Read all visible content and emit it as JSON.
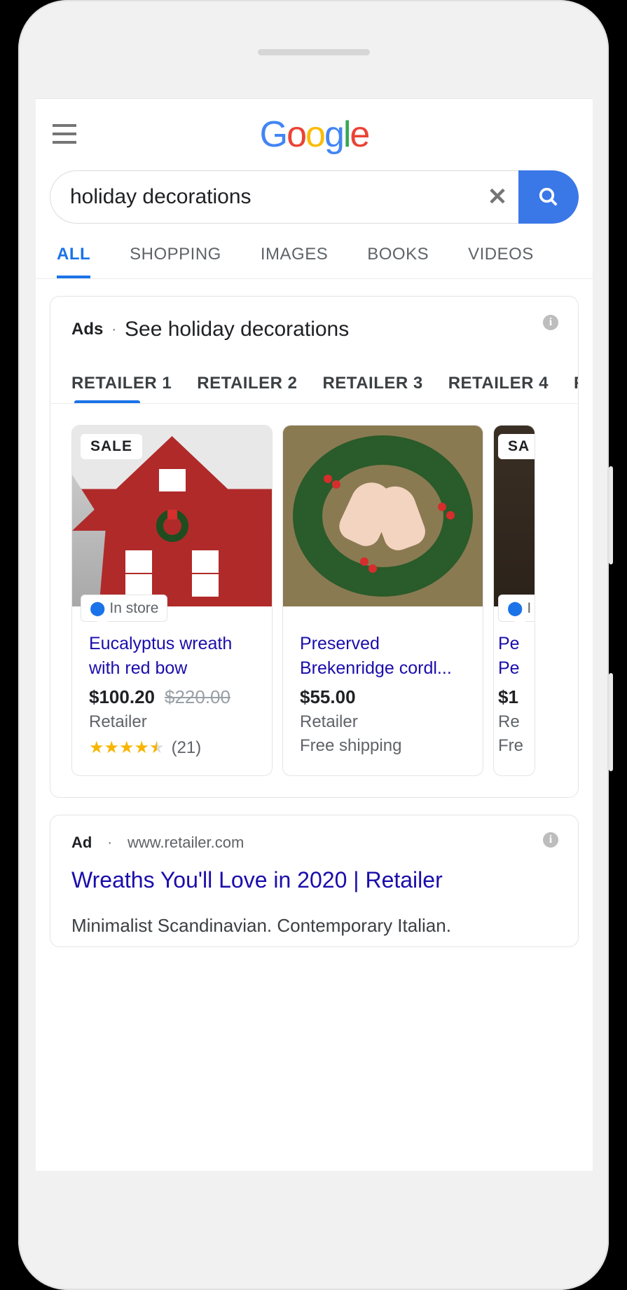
{
  "search": {
    "query": "holiday decorations"
  },
  "tabs": [
    "ALL",
    "SHOPPING",
    "IMAGES",
    "BOOKS",
    "VIDEOS"
  ],
  "shopping_unit": {
    "label": "Ads",
    "title": "See holiday decorations",
    "retailers": [
      "RETAILER 1",
      "RETAILER 2",
      "RETAILER 3",
      "RETAILER 4",
      "RE"
    ],
    "products": [
      {
        "sale_badge": "SALE",
        "in_store_badge": "In store",
        "name": "Eucalyptus wreath with red bow",
        "price": "$100.20",
        "old_price": "$220.00",
        "retailer": "Retailer",
        "rating_stars": 4.5,
        "rating_count": "(21)"
      },
      {
        "name": "Preserved Brekenridge cordl...",
        "price": "$55.00",
        "retailer": "Retailer",
        "note": "Free shipping"
      },
      {
        "sale_badge": "SA",
        "in_store_badge": "I",
        "name": "Pe",
        "name2": "Pe",
        "price": "$1",
        "retailer": "Re",
        "note": "Fre"
      }
    ]
  },
  "text_ad": {
    "label": "Ad",
    "url": "www.retailer.com",
    "headline": "Wreaths You'll Love in 2020 | Retailer",
    "description": "Minimalist Scandinavian. Contemporary Italian."
  }
}
